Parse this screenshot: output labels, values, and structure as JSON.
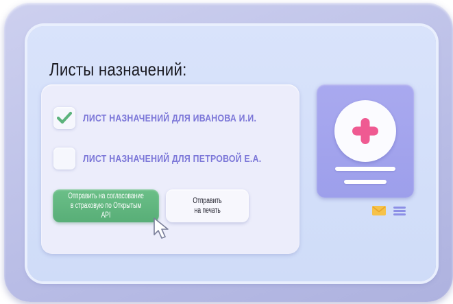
{
  "page": {
    "title": "Листы назначений:"
  },
  "list": {
    "items": [
      {
        "label": "ЛИСТ НАЗНАЧЕНИЙ ДЛЯ ИВАНОВА И.И.",
        "checked": true
      },
      {
        "label": "ЛИСТ НАЗНАЧЕНИЙ ДЛЯ ПЕТРОВОЙ Е.А.",
        "checked": false
      }
    ]
  },
  "actions": {
    "send_api": {
      "line1": "Отправить на согласование",
      "line2": "в страховую по Открытым API"
    },
    "print": {
      "line1": "Отправить",
      "line2": "на печать"
    }
  },
  "icons": {
    "checkmark": "check-icon",
    "medical": "medical-plus-icon",
    "mail": "envelope-icon",
    "menu": "menu-lines-icon",
    "cursor": "mouse-pointer-icon"
  },
  "colors": {
    "accent": "#7b76d8",
    "primary_button": "#5fb67f",
    "plus": "#ef5a92",
    "doc_card": "#a4a5ee",
    "mail": "#f6c24a"
  }
}
